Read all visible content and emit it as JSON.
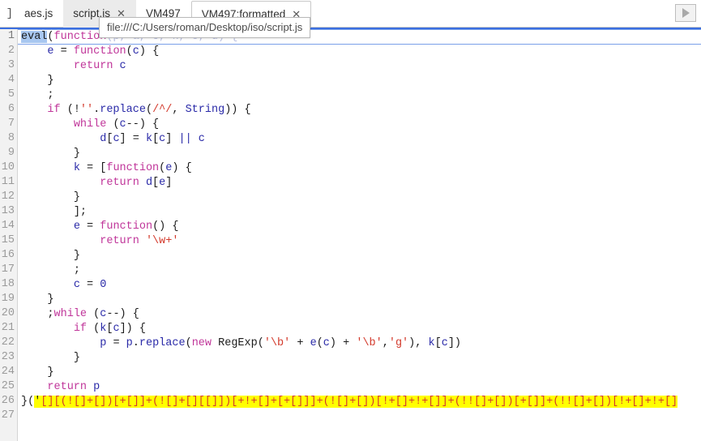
{
  "window": {
    "corner_icon_glyph": "]",
    "colors": {
      "accent": "#3b6fe0",
      "selection": "#a8c7f0",
      "highlight": "#ffff00",
      "keyword": "#c0369a",
      "identifier": "#2a2aa8",
      "string": "#d33a2c",
      "gutter_bg": "#f2f2f2",
      "tab_hover_bg": "#ebebeb"
    }
  },
  "tabstrip": {
    "tabs": [
      {
        "label": "aes.js",
        "closable": false,
        "state": "inactive"
      },
      {
        "label": "script.js",
        "closable": true,
        "state": "hovered"
      },
      {
        "label": "VM497",
        "closable": false,
        "state": "inactive"
      },
      {
        "label": "VM497:formatted",
        "closable": true,
        "state": "active"
      }
    ],
    "close_glyph": "✕",
    "play_button": {
      "name": "resume-script-execution",
      "glyph": "▶"
    }
  },
  "tooltip": {
    "text": "file:///C:/Users/roman/Desktop/iso/script.js"
  },
  "editor": {
    "line_numbers": [
      "1",
      "2",
      "3",
      "4",
      "5",
      "6",
      "7",
      "8",
      "9",
      "10",
      "11",
      "12",
      "13",
      "14",
      "15",
      "16",
      "17",
      "18",
      "19",
      "20",
      "21",
      "22",
      "23",
      "24",
      "25",
      "26",
      "27"
    ],
    "code_lines": [
      "eval(function(p, a, c, k, e, d) {",
      "    e = function(c) {",
      "        return c",
      "    }",
      "    ;",
      "    if (!''.replace(/^/, String)) {",
      "        while (c--) {",
      "            d[c] = k[c] || c",
      "        }",
      "        k = [function(e) {",
      "            return d[e]",
      "        }",
      "        ];",
      "        e = function() {",
      "            return '\\w+'",
      "        }",
      "        ;",
      "        c = 0",
      "    }",
      "    ;while (c--) {",
      "        if (k[c]) {",
      "            p = p.replace(new RegExp('\\b' + e(c) + '\\b','g'), k[c])",
      "        }",
      "    }",
      "    return p",
      "}('[][(![]+[])[+[]]+(![]+[][[]])[+!+[]+[+[]]]+(![]+[])[!+[]+!+[]]+(!![]+[])[+[]]+(!![]+[])[!+[]+!+[]",
      ""
    ],
    "selected_text": "eval",
    "highlighted_line_index": 25
  }
}
